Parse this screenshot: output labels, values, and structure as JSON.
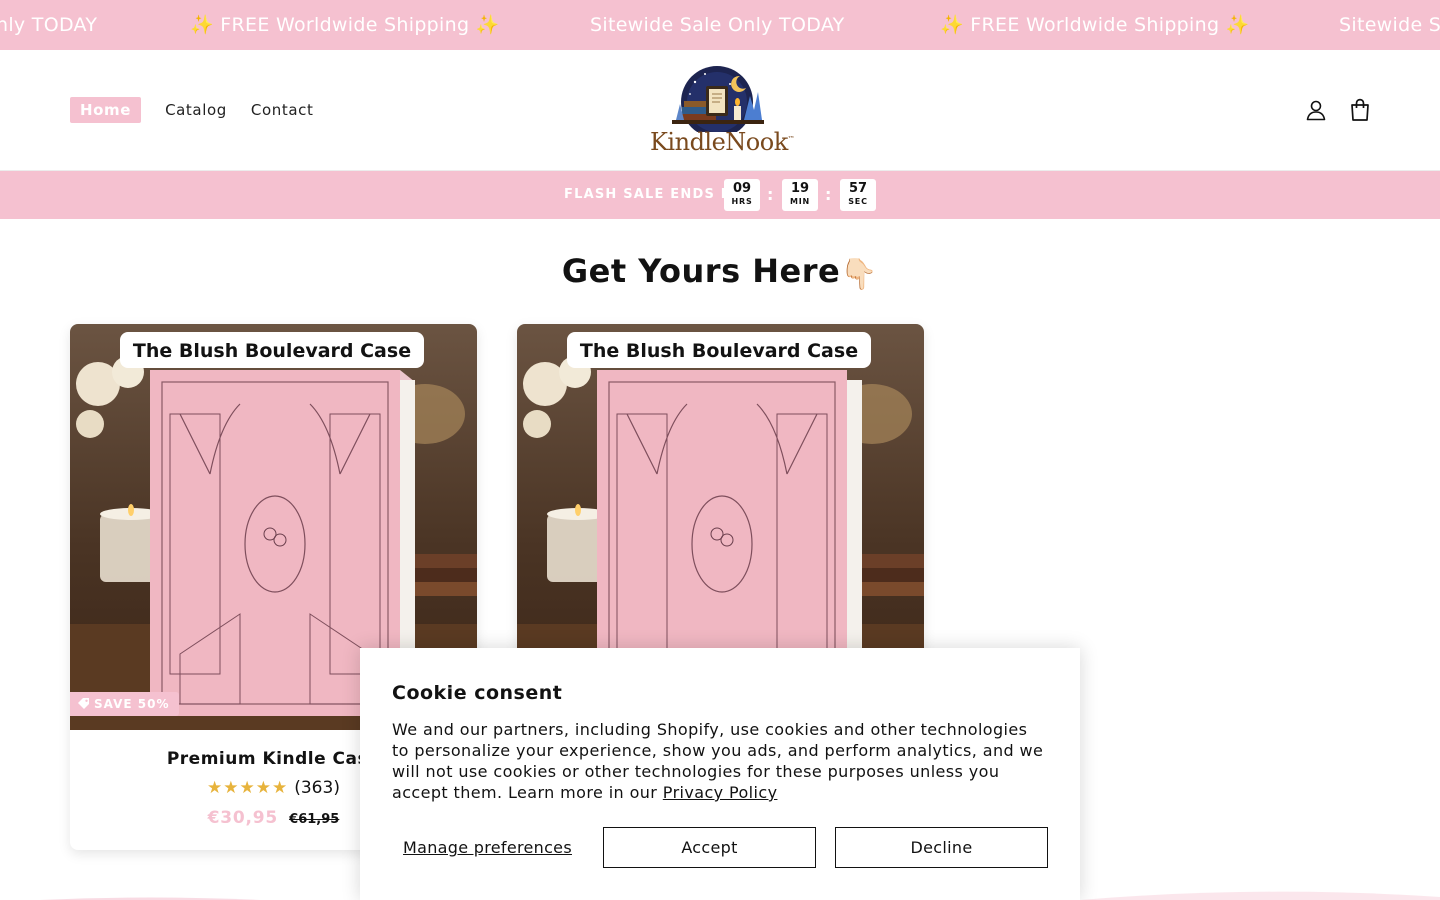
{
  "announcement": {
    "items": [
      "nly TODAY",
      "✨ FREE Worldwide Shipping ✨",
      "Sitewide Sale Only TODAY",
      "✨ FREE Worldwide Shipping ✨",
      "Sitewide S"
    ]
  },
  "header": {
    "nav": {
      "home": "Home",
      "catalog": "Catalog",
      "contact": "Contact"
    },
    "logo": {
      "brand": "KindleNook",
      "trademark": "™"
    },
    "account_icon": "account-icon",
    "cart_icon": "cart-icon"
  },
  "flash_sale": {
    "label": "FLASH SALE ENDS IN",
    "hours": "09",
    "hours_unit": "HRS",
    "minutes": "19",
    "minutes_unit": "MIN",
    "seconds": "57",
    "seconds_unit": "SEC",
    "separator": ":"
  },
  "section": {
    "title": "Get Yours Here",
    "emoji": "👇🏻"
  },
  "products": [
    {
      "image_caption": "The Blush Boulevard Case",
      "badge": "SAVE 50%",
      "title": "Premium Kindle Case",
      "stars": "★★★★★",
      "review_count": "(363)",
      "price": "€30,95",
      "compare_price": "€61,95"
    },
    {
      "image_caption": "The Blush Boulevard Case"
    }
  ],
  "cookie": {
    "title": "Cookie consent",
    "text": "We and our partners, including Shopify, use cookies and other technologies to personalize your experience, show you ads, and perform analytics, and we will not use cookies or other technologies for these purposes unless you accept them. Learn more in our",
    "link": "Privacy Policy",
    "manage": "Manage preferences",
    "accept": "Accept",
    "decline": "Decline"
  },
  "colors": {
    "accent_pink": "#f5c1d0",
    "text": "#121212",
    "star": "#e7b33c"
  }
}
